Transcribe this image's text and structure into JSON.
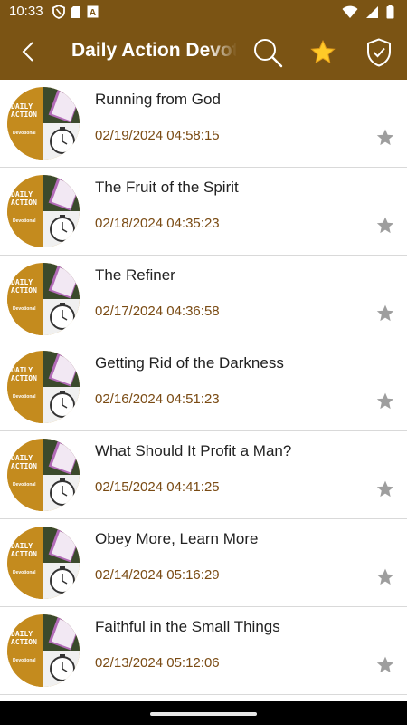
{
  "status_bar": {
    "time": "10:33",
    "icons": [
      "vpn-shield-icon",
      "sd-card-icon",
      "font-a-icon",
      "wifi-icon",
      "signal-icon",
      "battery-icon"
    ]
  },
  "app_bar": {
    "title": "Daily Action Devotional",
    "background": "#7b5414",
    "icons": [
      "back-arrow-icon",
      "search-icon",
      "favorites-star-icon",
      "shield-check-icon"
    ]
  },
  "thumbnail": {
    "text_line1": "DAILY",
    "text_line2": "ACTION",
    "text_line3": "Devotional",
    "bg": "#c48b1e"
  },
  "devotionals": [
    {
      "title": "Running from God",
      "date": "02/19/2024 04:58:15"
    },
    {
      "title": "The Fruit of the Spirit",
      "date": "02/18/2024 04:35:23"
    },
    {
      "title": "The Refiner",
      "date": "02/17/2024 04:36:58"
    },
    {
      "title": "Getting Rid of the Darkness",
      "date": "02/16/2024 04:51:23"
    },
    {
      "title": "What Should It Profit a Man?",
      "date": "02/15/2024 04:41:25"
    },
    {
      "title": "Obey More, Learn More",
      "date": "02/14/2024 05:16:29"
    },
    {
      "title": "Faithful in the Small Things",
      "date": "02/13/2024 05:12:06"
    }
  ],
  "colors": {
    "date_text": "#7a4b14",
    "star_inactive": "#9e9e9e",
    "star_active": "#ffca28"
  }
}
